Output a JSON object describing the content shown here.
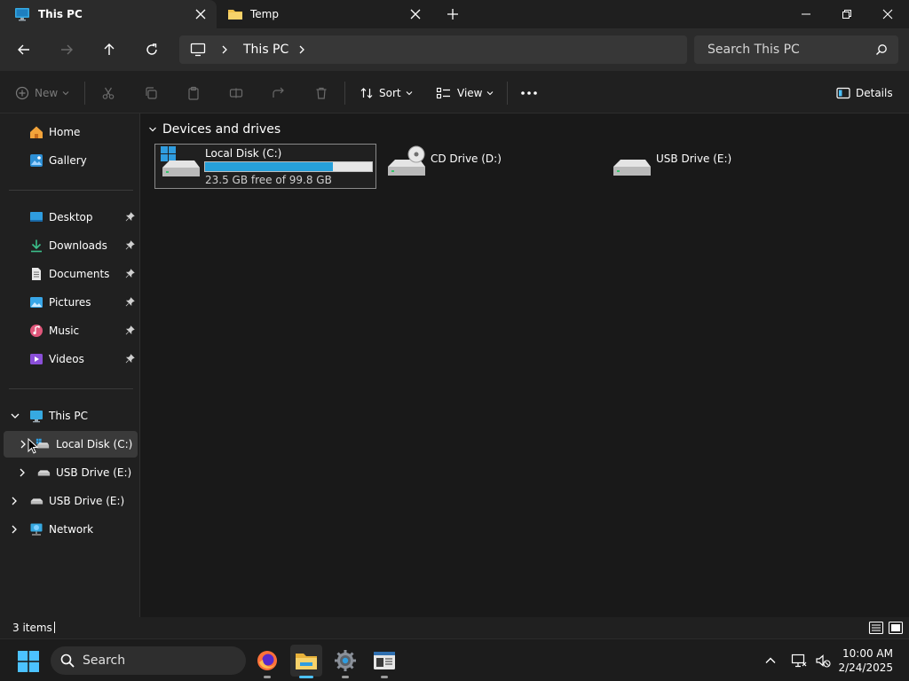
{
  "tabs": [
    {
      "label": "This PC",
      "active": true
    },
    {
      "label": "Temp",
      "active": false
    }
  ],
  "address": {
    "crumb": "This PC"
  },
  "search": {
    "placeholder": "Search This PC"
  },
  "commands": {
    "new_label": "New",
    "sort_label": "Sort",
    "view_label": "View",
    "details_label": "Details"
  },
  "sidebar": {
    "quick": [
      {
        "label": "Home"
      },
      {
        "label": "Gallery"
      }
    ],
    "pinned": [
      {
        "label": "Desktop"
      },
      {
        "label": "Downloads"
      },
      {
        "label": "Documents"
      },
      {
        "label": "Pictures"
      },
      {
        "label": "Music"
      },
      {
        "label": "Videos"
      }
    ],
    "tree": [
      {
        "label": "This PC"
      },
      {
        "label": "Local Disk (C:)"
      },
      {
        "label": "USB Drive (E:)"
      },
      {
        "label": "USB Drive (E:)"
      },
      {
        "label": "Network"
      }
    ]
  },
  "content": {
    "group_label": "Devices and drives",
    "drives": [
      {
        "name": "Local Disk (C:)",
        "free_text": "23.5 GB free of 99.8 GB",
        "used_fraction": 0.765
      },
      {
        "name": "CD Drive (D:)"
      },
      {
        "name": "USB Drive (E:)"
      }
    ]
  },
  "status": {
    "item_count": "3 items"
  },
  "taskbar": {
    "search_placeholder": "Search",
    "time": "10:00 AM",
    "date": "2/24/2025"
  },
  "colors": {
    "accent": "#4cc2ff",
    "progress": "#26a0da",
    "background": "#191919"
  }
}
